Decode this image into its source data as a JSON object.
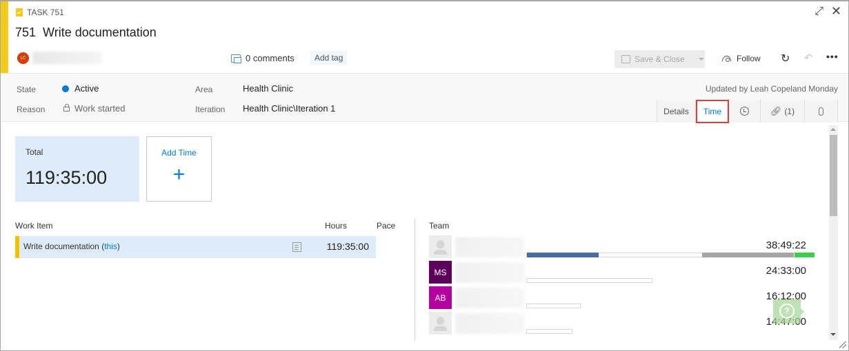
{
  "header": {
    "type_label": "TASK 751",
    "id": "751",
    "title": "Write documentation",
    "assignee_initials": "LC",
    "comments_label": "0 comments",
    "add_tag_label": "Add tag",
    "save_close_label": "Save & Close",
    "follow_label": "Follow",
    "expand_icon": "expand-icon",
    "close_icon": "close-icon",
    "refresh_icon": "refresh-icon",
    "undo_icon": "undo-icon",
    "more_icon": "more-icon",
    "colors": {
      "accent": "#f2cb1d",
      "assignee": "#d83b01"
    }
  },
  "fields": {
    "state_label": "State",
    "state_value": "Active",
    "state_color": "#0078d4",
    "reason_label": "Reason",
    "reason_value": "Work started",
    "area_label": "Area",
    "area_value": "Health Clinic",
    "iteration_label": "Iteration",
    "iteration_value": "Health Clinic\\Iteration 1",
    "updated_text": "Updated by Leah Copeland Monday"
  },
  "tabs": [
    {
      "label": "Details",
      "active": false
    },
    {
      "label": "Time",
      "active": true
    },
    {
      "label": "",
      "icon": "history-icon",
      "active": false
    },
    {
      "label": "(1)",
      "icon": "link-icon",
      "active": false
    },
    {
      "label": "",
      "icon": "attachment-icon",
      "active": false
    }
  ],
  "time": {
    "total_label": "Total",
    "total_value": "119:35:00",
    "add_time_label": "Add Time",
    "add_time_plus": "+"
  },
  "work_items": {
    "headers": {
      "item": "Work Item",
      "hours": "Hours",
      "pace": "Pace"
    },
    "rows": [
      {
        "name": "Write documentation",
        "this_prefix": "(",
        "this_label": "this",
        "this_suffix": ")",
        "hours": "119:35:00"
      }
    ]
  },
  "team": {
    "header": "Team",
    "members": [
      {
        "initials": "",
        "avatar_color": "",
        "time": "38:49:22",
        "bar_fraction": 0.75,
        "segments": [
          {
            "color": "#4a6aa5",
            "start": 0.0,
            "end": 0.25
          },
          {
            "color": "#a6a6a8",
            "start": 0.61,
            "end": 0.93
          },
          {
            "color": "#3ccd4b",
            "start": 0.93,
            "end": 1.0
          }
        ]
      },
      {
        "initials": "MS",
        "avatar_color": "#5c005c",
        "time": "24:33:00",
        "bar_fraction": 0.44,
        "segments": []
      },
      {
        "initials": "AB",
        "avatar_color": "#b4009e",
        "time": "16:12:00",
        "bar_fraction": 0.19,
        "segments": []
      },
      {
        "initials": "",
        "avatar_color": "",
        "time": "14:47:00",
        "bar_fraction": 0.16,
        "segments": []
      }
    ]
  },
  "help": {
    "label": "?"
  }
}
